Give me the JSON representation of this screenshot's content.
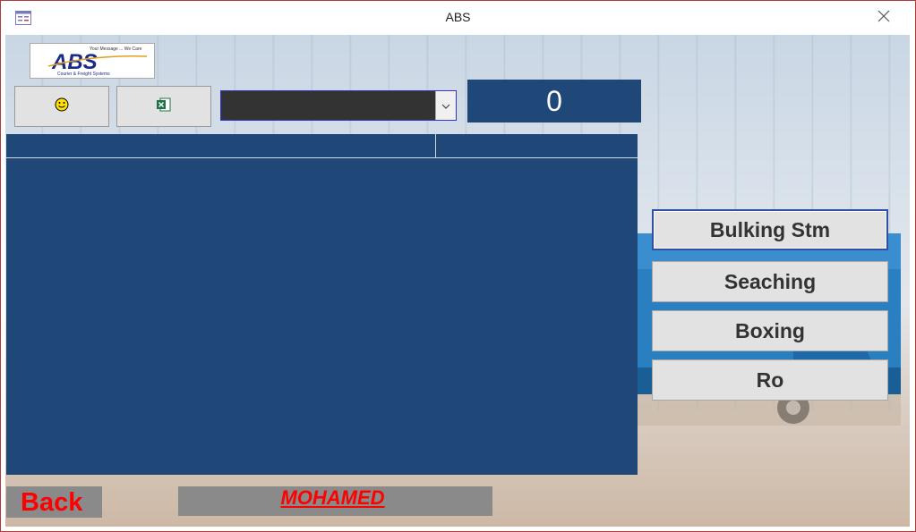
{
  "window": {
    "title": "ABS",
    "icon": "form-icon",
    "close_icon": "close-icon"
  },
  "logo": {
    "text": "ABS",
    "tagline": "Your Message ... We Care",
    "subtitle": "Courier & Freight Systems"
  },
  "toolbar": {
    "smiley_icon": "smiley-icon",
    "excel_icon": "excel-icon",
    "combo_value": "",
    "counter_value": "0"
  },
  "grid": {
    "columns": [
      "",
      ""
    ],
    "rows": []
  },
  "side_buttons": [
    {
      "label": "Bulking Stm"
    },
    {
      "label": "Seaching"
    },
    {
      "label": "Boxing"
    },
    {
      "label": "Ro"
    }
  ],
  "footer": {
    "back_label": "Back",
    "user_name": "MOHAMED"
  },
  "colors": {
    "accent": "#1f4878",
    "button_bg": "#e2e2e2",
    "footer_bg": "#8a8a8a",
    "footer_text": "#ff0000"
  }
}
